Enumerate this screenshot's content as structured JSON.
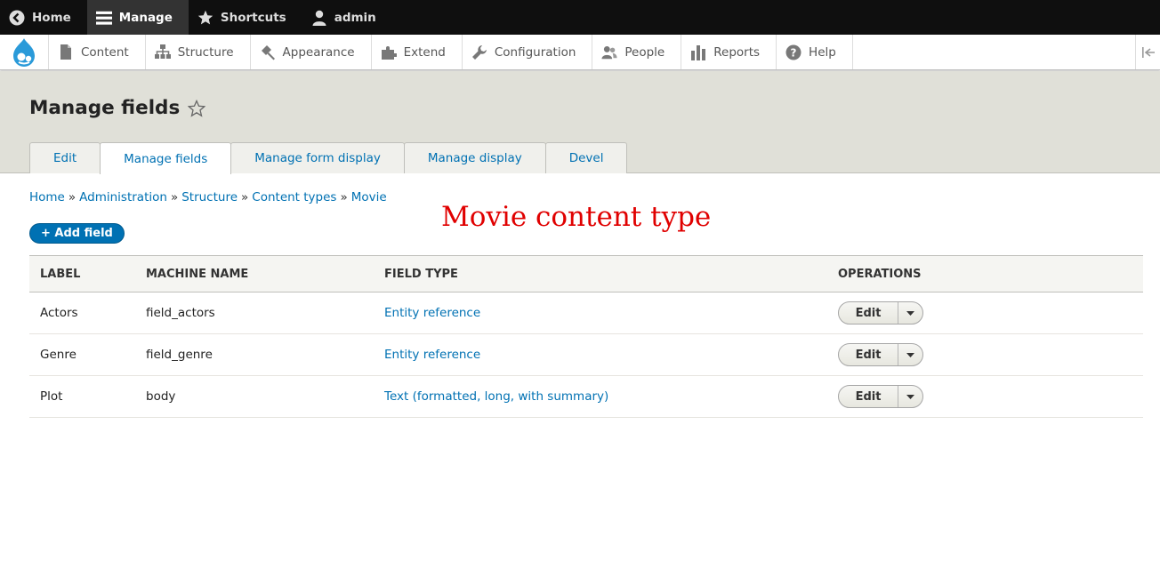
{
  "toolbar": {
    "home": "Home",
    "manage": "Manage",
    "shortcuts": "Shortcuts",
    "user": "admin"
  },
  "admin_menu": {
    "items": [
      "Content",
      "Structure",
      "Appearance",
      "Extend",
      "Configuration",
      "People",
      "Reports",
      "Help"
    ]
  },
  "page": {
    "title": "Manage fields"
  },
  "tabs": [
    "Edit",
    "Manage fields",
    "Manage form display",
    "Manage display",
    "Devel"
  ],
  "active_tab": "Manage fields",
  "breadcrumb": [
    "Home",
    "Administration",
    "Structure",
    "Content types",
    "Movie"
  ],
  "breadcrumb_separator": "»",
  "annotation": "Movie content type",
  "add_field_button": "+ Add field",
  "table": {
    "headers": [
      "Label",
      "Machine name",
      "Field type",
      "Operations"
    ],
    "rows": [
      {
        "label": "Actors",
        "machine_name": "field_actors",
        "field_type": "Entity reference",
        "operation": "Edit"
      },
      {
        "label": "Genre",
        "machine_name": "field_genre",
        "field_type": "Entity reference",
        "operation": "Edit"
      },
      {
        "label": "Plot",
        "machine_name": "body",
        "field_type": "Text (formatted, long, with summary)",
        "operation": "Edit"
      }
    ]
  },
  "colors": {
    "link": "#0071b3",
    "toolbar_bg": "#0f0f0f",
    "header_bg": "#e0e0d8",
    "annotation": "#e00000",
    "drupal_blue": "#2a9ad9"
  }
}
